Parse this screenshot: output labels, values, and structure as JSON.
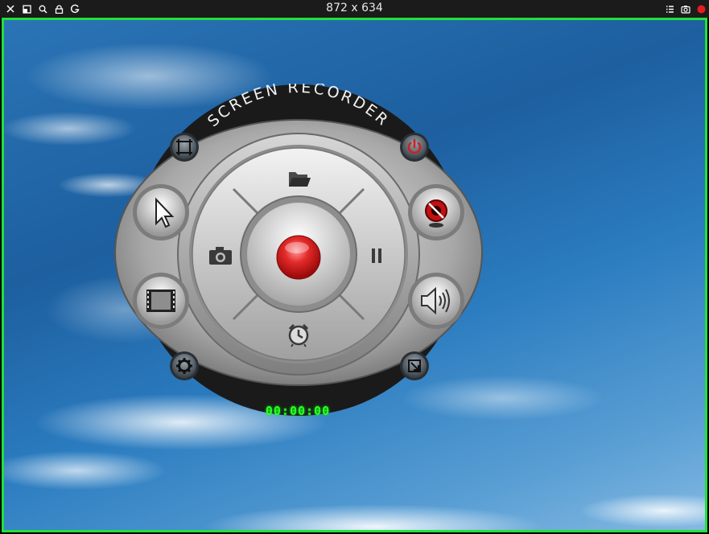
{
  "toolbar": {
    "size_label": "872 x 634",
    "icons": [
      "close-icon",
      "restore-icon",
      "search-icon",
      "lock-icon",
      "g-icon",
      "list-icon",
      "camera-icon",
      "record-indicator-icon"
    ]
  },
  "recorder": {
    "title": "SCREEN RECORDER",
    "timer": "00:00:00",
    "buttons": [
      "select-region",
      "power",
      "cursor",
      "webcam",
      "video",
      "volume",
      "settings",
      "resize",
      "open-folder",
      "screenshot",
      "record",
      "pause",
      "schedule"
    ]
  },
  "colors": {
    "capture_border": "#22e03a",
    "record_button": "#e02020",
    "timer_text": "#2bff2b",
    "power_icon": "#d02020"
  }
}
